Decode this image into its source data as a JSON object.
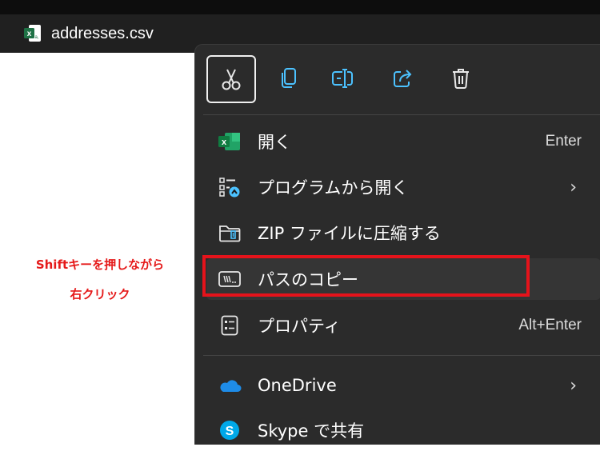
{
  "file": {
    "name": "addresses.csv",
    "icon": "excel-csv-icon"
  },
  "annotation": {
    "line1": "Shiftキーを押しながら",
    "line2": "右クリック"
  },
  "quick_actions": [
    {
      "name": "cut-button",
      "icon": "scissors-icon"
    },
    {
      "name": "copy-button",
      "icon": "copy-icon"
    },
    {
      "name": "rename-button",
      "icon": "rename-icon"
    },
    {
      "name": "share-button",
      "icon": "share-icon"
    },
    {
      "name": "delete-button",
      "icon": "trash-icon"
    }
  ],
  "menu": {
    "open": {
      "label": "開く",
      "accel": "Enter",
      "icon": "excel-icon"
    },
    "open_with": {
      "label": "プログラムから開く",
      "icon": "open-with-icon"
    },
    "zip": {
      "label": "ZIP ファイルに圧縮する",
      "icon": "zip-folder-icon"
    },
    "copy_path": {
      "label": "パスのコピー",
      "icon": "path-icon"
    },
    "properties": {
      "label": "プロパティ",
      "accel": "Alt+Enter",
      "icon": "properties-icon"
    },
    "onedrive": {
      "label": "OneDrive",
      "icon": "cloud-icon"
    },
    "skype": {
      "label": "Skype で共有",
      "icon": "skype-icon"
    }
  },
  "colors": {
    "menu_bg": "#2b2b2b",
    "highlight": "#e5131b",
    "accent": "#4cc2ff",
    "excel": "#1e7145"
  }
}
